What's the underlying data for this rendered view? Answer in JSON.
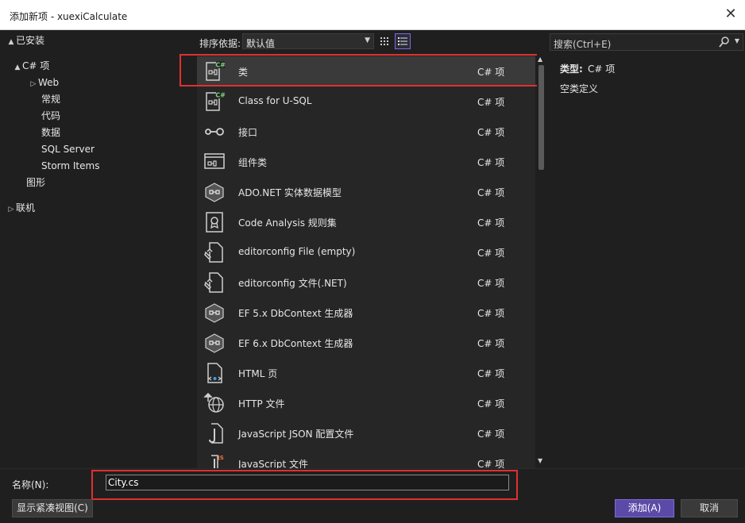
{
  "window": {
    "title": "添加新项 - xuexiCalculate"
  },
  "tree": [
    {
      "label": "已安装",
      "expander": "▲"
    },
    {
      "label": "C# 项",
      "expander": "▲"
    },
    {
      "label": "Web",
      "expander": "▷"
    },
    {
      "label": "常规",
      "expander": ""
    },
    {
      "label": "代码",
      "expander": ""
    },
    {
      "label": "数据",
      "expander": ""
    },
    {
      "label": "SQL Server",
      "expander": ""
    },
    {
      "label": "Storm Items",
      "expander": ""
    },
    {
      "label": "图形",
      "expander": ""
    },
    {
      "label": "联机",
      "expander": "▷"
    }
  ],
  "toolbar": {
    "sort_label": "排序依据:",
    "sort_value": "默认值"
  },
  "items": [
    {
      "name": "类",
      "type": "C# 项",
      "icon": "csharp-class-icon",
      "selected": true
    },
    {
      "name": "Class for U-SQL",
      "type": "C# 项",
      "icon": "usql-class-icon"
    },
    {
      "name": "接口",
      "type": "C# 项",
      "icon": "interface-icon"
    },
    {
      "name": "组件类",
      "type": "C# 项",
      "icon": "component-class-icon"
    },
    {
      "name": "ADO.NET 实体数据模型",
      "type": "C# 项",
      "icon": "entity-model-icon"
    },
    {
      "name": "Code Analysis 规则集",
      "type": "C# 项",
      "icon": "ruleset-icon"
    },
    {
      "name": "editorconfig File (empty)",
      "type": "C# 项",
      "icon": "editorconfig-icon"
    },
    {
      "name": "editorconfig 文件(.NET)",
      "type": "C# 项",
      "icon": "editorconfig-icon"
    },
    {
      "name": "EF 5.x DbContext 生成器",
      "type": "C# 项",
      "icon": "entity-model-icon"
    },
    {
      "name": "EF 6.x DbContext 生成器",
      "type": "C# 项",
      "icon": "entity-model-icon"
    },
    {
      "name": "HTML 页",
      "type": "C# 项",
      "icon": "html-page-icon"
    },
    {
      "name": "HTTP 文件",
      "type": "C# 项",
      "icon": "http-file-icon"
    },
    {
      "name": "JavaScript JSON 配置文件",
      "type": "C# 项",
      "icon": "json-config-icon"
    },
    {
      "name": "JavaScript 文件",
      "type": "C# 项",
      "icon": "javascript-file-icon"
    }
  ],
  "search": {
    "placeholder": "搜索(Ctrl+E)"
  },
  "details": {
    "type_label": "类型:",
    "type_value": "C# 项",
    "description": "空类定义"
  },
  "bottom": {
    "name_label": "名称(N):",
    "name_value": "City.cs",
    "compact_label": "显示紧凑视图(C)",
    "add_label": "添加(A)",
    "cancel_label": "取消"
  },
  "colors": {
    "accent": "#5b4aa8",
    "highlight_border": "#e0302f",
    "background": "#1f1f1f"
  }
}
